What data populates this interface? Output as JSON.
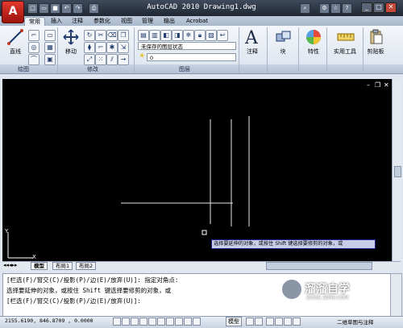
{
  "app": {
    "title": "AutoCAD 2010  Drawing1.dwg",
    "logo_letter": "A"
  },
  "tabs": [
    "常用",
    "插入",
    "注释",
    "参数化",
    "视图",
    "管理",
    "输出",
    "Acrobat"
  ],
  "ribbon": {
    "draw_panel": "绘图",
    "modify_panel": "修改",
    "layer_panel": "图层",
    "line_label": "直线",
    "move_label": "移动",
    "layer_state": "未保存的图层状态",
    "layer_current": "0",
    "annotate_label": "注释",
    "block_label": "块",
    "properties_label": "特性",
    "utilities_label": "实用工具",
    "clipboard_label": "剪贴板"
  },
  "layout_tabs": [
    "模型",
    "布局1",
    "布局2"
  ],
  "tooltip": "选择要延伸的对象，或按住 Shift 键选择要修剪的对象，或",
  "command": {
    "line1": "[栏选(F)/窗交(C)/投影(P)/边(E)/放弃(U)]:  指定对角点:",
    "line2": "选择要延伸的对象，或按住 Shift 键选择要修剪的对象，或",
    "line3": "[栏选(F)/窗交(C)/投影(P)/边(E)/放弃(U)]:"
  },
  "status": {
    "coordinates": "2155.6190, 846.8709 , 0.0000",
    "model_label": "模型",
    "workspace": "二维草图与注释"
  },
  "ucs": {
    "x": "X",
    "y": "Y"
  },
  "watermark": {
    "title": "溜溜自学",
    "subtitle": "ZIXUE.3D66.COM"
  }
}
